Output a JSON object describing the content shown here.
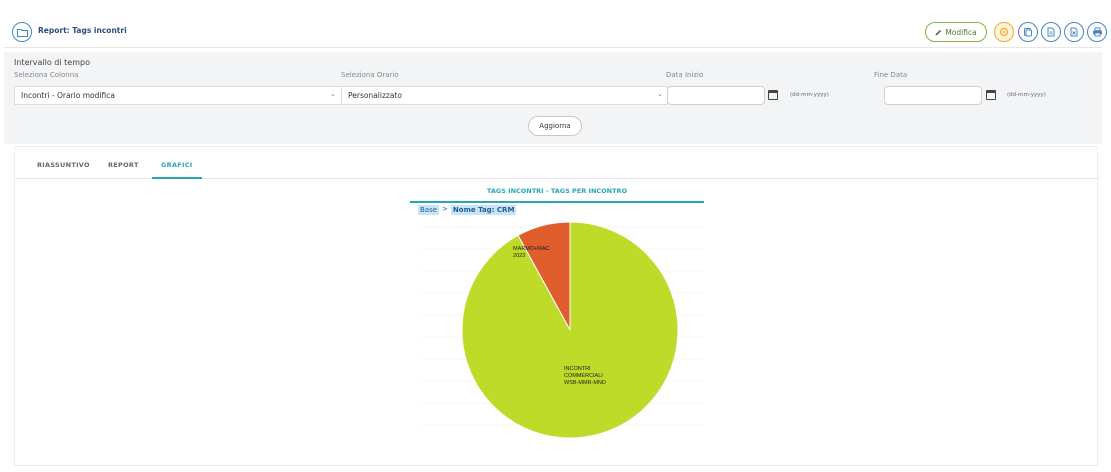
{
  "header": {
    "title": "Report: Tags incontri",
    "modifica_label": "Modifica"
  },
  "filters": {
    "section_title": "Intervallo di tempo",
    "colonna": {
      "label": "Seleziona Colonna",
      "value": "Incontri - Orario modifica"
    },
    "orario": {
      "label": "Seleziona Orario",
      "value": "Personalizzato"
    },
    "data_inizio": {
      "label": "Data Inizio",
      "value": "",
      "format_hint": "(dd-mm-yyyy)"
    },
    "fine_data": {
      "label": "Fine Data",
      "value": "",
      "format_hint": "(dd-mm-yyyy)"
    },
    "aggiorna_label": "Aggiorna"
  },
  "tabs": [
    {
      "label": "RIASSUNTIVO",
      "active": false
    },
    {
      "label": "REPORT",
      "active": false
    },
    {
      "label": "GRAFICI",
      "active": true
    }
  ],
  "chart": {
    "title": "TAGS INCONTRI - TAGS PER INCONTRO",
    "breadcrumb": {
      "base": "Base",
      "separator": ">",
      "current": "Nome Tag: CRM"
    }
  },
  "chart_data": {
    "type": "pie",
    "title": "TAGS INCONTRI - TAGS PER INCONTRO",
    "slices": [
      {
        "label": "INCONTRI COMMERCIALI WSB-MMR-MND",
        "label_lines": [
          "INCONTRI",
          "COMMERCIALI",
          "WSB-MMR-MND"
        ],
        "value": 92,
        "color": "#bedb2a"
      },
      {
        "label": "MARMO+MAC 2023",
        "label_lines": [
          "MARMO+MAC",
          "2023"
        ],
        "value": 8,
        "color": "#e05d2c"
      }
    ]
  },
  "colors": {
    "accent": "#29a4b5",
    "brand_blue": "#4a86c5",
    "modifica_green": "#7ab648",
    "orange": "#f5a623"
  }
}
